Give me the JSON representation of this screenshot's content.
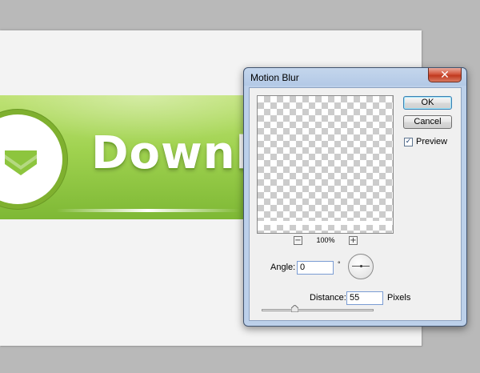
{
  "artwork": {
    "banner_text": "Downlo"
  },
  "dialog": {
    "title": "Motion Blur",
    "close_glyph": "✕",
    "buttons": {
      "ok": "OK",
      "cancel": "Cancel"
    },
    "preview": {
      "label": "Preview",
      "checked": true,
      "check_glyph": "✓"
    },
    "zoom": {
      "minus": "−",
      "plus": "+",
      "level": "100%"
    },
    "angle": {
      "label": "Angle:",
      "value": "0",
      "unit": "°"
    },
    "distance": {
      "label": "Distance:",
      "value": "55",
      "unit": "Pixels",
      "slider_fraction": 0.28
    }
  },
  "colors": {
    "banner_green": "#9fd24f",
    "dialog_frame": "#b3c9e6",
    "close_red": "#c0391f"
  }
}
